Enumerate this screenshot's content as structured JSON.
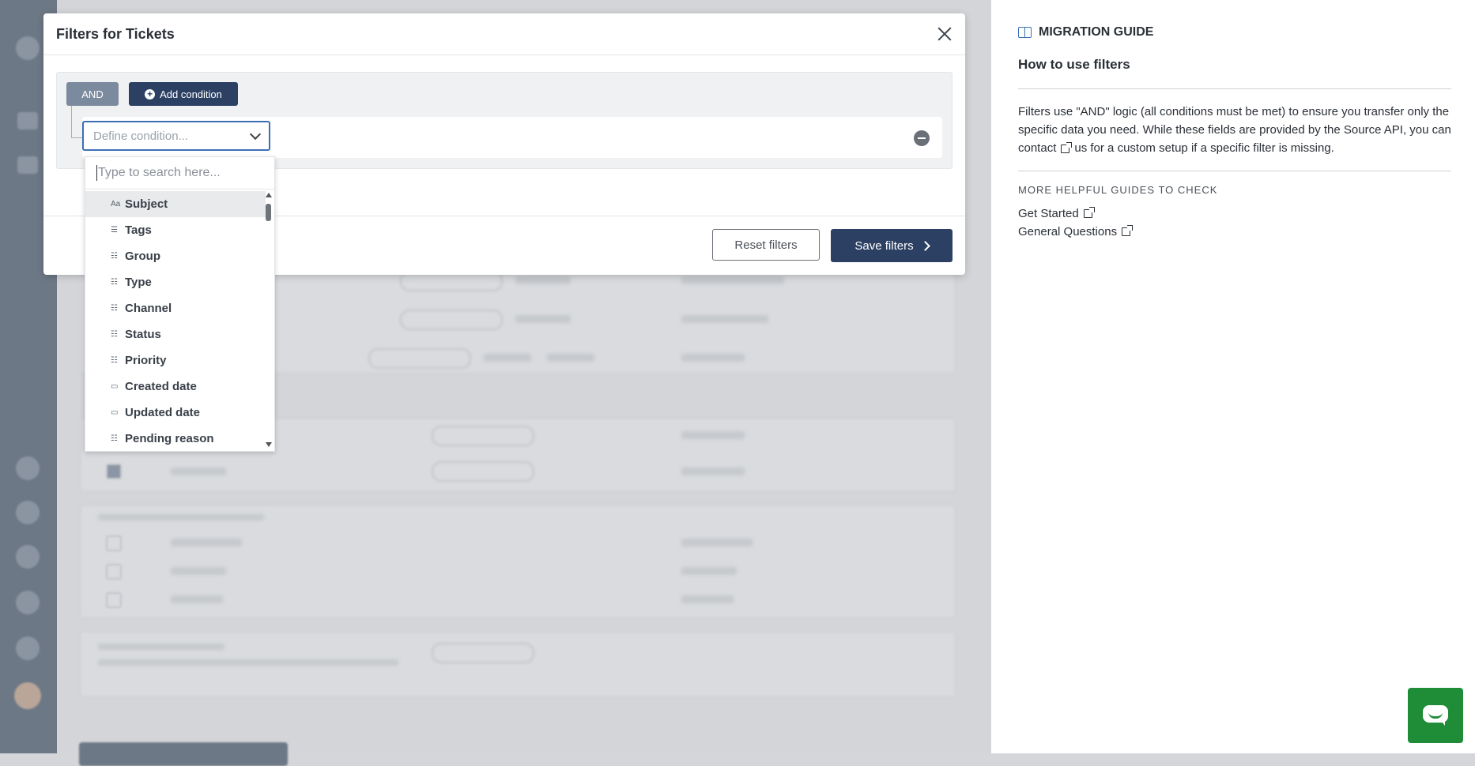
{
  "modal": {
    "title": "Filters for Tickets",
    "logic_label": "AND",
    "add_condition_label": "Add condition",
    "condition_placeholder": "Define condition...",
    "reset_label": "Reset filters",
    "save_label": "Save filters"
  },
  "dropdown": {
    "search_placeholder": "Type to search here...",
    "items": [
      {
        "icon": "Aa",
        "label": "Subject"
      },
      {
        "icon": "☰",
        "label": "Tags"
      },
      {
        "icon": "☷",
        "label": "Group"
      },
      {
        "icon": "☷",
        "label": "Type"
      },
      {
        "icon": "☷",
        "label": "Channel"
      },
      {
        "icon": "☷",
        "label": "Status"
      },
      {
        "icon": "☷",
        "label": "Priority"
      },
      {
        "icon": "▭",
        "label": "Created date"
      },
      {
        "icon": "▭",
        "label": "Updated date"
      },
      {
        "icon": "☷",
        "label": "Pending reason"
      }
    ]
  },
  "guide": {
    "heading": "MIGRATION GUIDE",
    "subheading": "How to use filters",
    "text_part1": "Filters use \"AND\" logic (all conditions must be met) to ensure you transfer only the specific data you need. While these fields are provided by the Source API, you can",
    "contact_label": "contact",
    "text_part2": "us for a custom setup if a specific filter is missing.",
    "more_heading": "MORE HELPFUL GUIDES TO CHECK",
    "links": [
      "Get Started",
      "General Questions"
    ]
  },
  "colors": {
    "primary": "#2b4063",
    "and_button": "#7c8a9e",
    "focus_border": "#3b6fb5",
    "chat": "#1f8d38"
  }
}
